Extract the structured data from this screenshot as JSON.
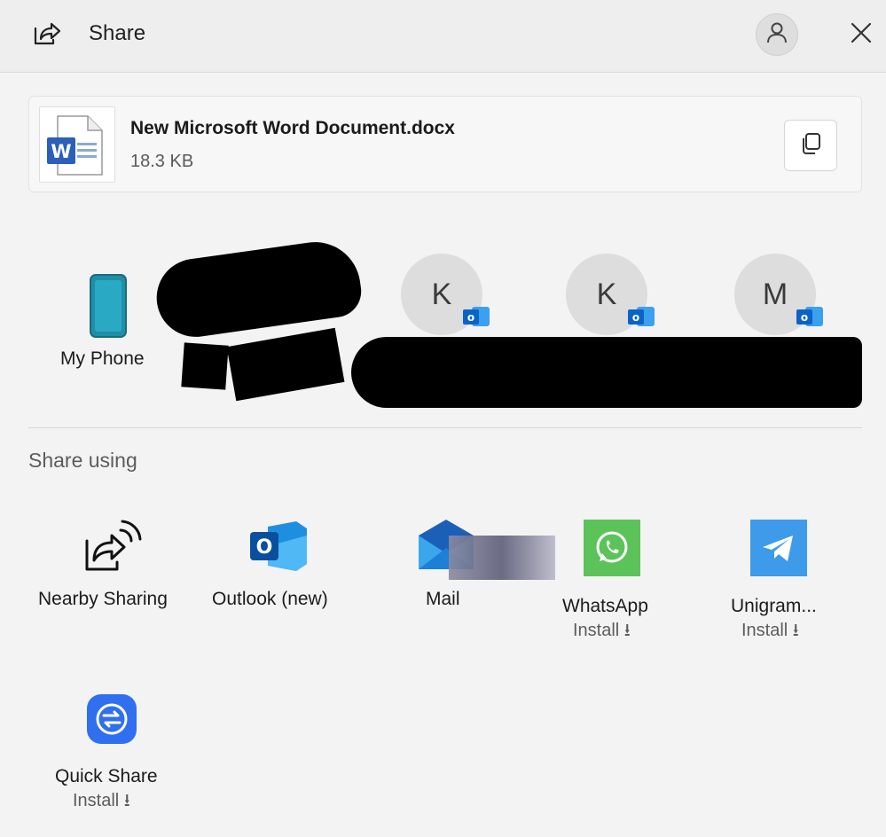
{
  "header": {
    "title": "Share",
    "share_icon": "share-icon",
    "account_icon": "person-icon",
    "close_icon": "close-icon"
  },
  "file": {
    "name": "New Microsoft Word Document.docx",
    "size": "18.3 KB",
    "type_icon": "word-document-icon",
    "copy_icon": "copy-icon"
  },
  "nearby_devices": [
    {
      "label": "My Phone",
      "icon": "phone-icon"
    }
  ],
  "contacts": [
    {
      "initial": "K",
      "badge_icon": "outlook-icon"
    },
    {
      "initial": "K",
      "badge_icon": "outlook-icon"
    },
    {
      "initial": "M",
      "badge_icon": "outlook-icon"
    }
  ],
  "share_using": {
    "title": "Share using",
    "apps": [
      {
        "label": "Nearby Sharing",
        "icon": "nearby-sharing-icon",
        "install": ""
      },
      {
        "label": "Outlook (new)",
        "icon": "outlook-icon",
        "install": ""
      },
      {
        "label": "Mail",
        "icon": "mail-icon",
        "install": ""
      },
      {
        "label": "WhatsApp",
        "icon": "whatsapp-icon",
        "install": "Install ⭳"
      },
      {
        "label": "Unigram...",
        "icon": "telegram-icon",
        "install": "Install ⭳"
      },
      {
        "label": "Quick Share",
        "icon": "quick-share-icon",
        "install": "Install ⭳"
      }
    ]
  },
  "colors": {
    "background": "#f3f3f3",
    "outlook_blue": "#0a64c8",
    "whatsapp_green": "#5cc35a",
    "telegram_blue": "#3d9be9",
    "quick_share_blue": "#2f6ff0"
  }
}
